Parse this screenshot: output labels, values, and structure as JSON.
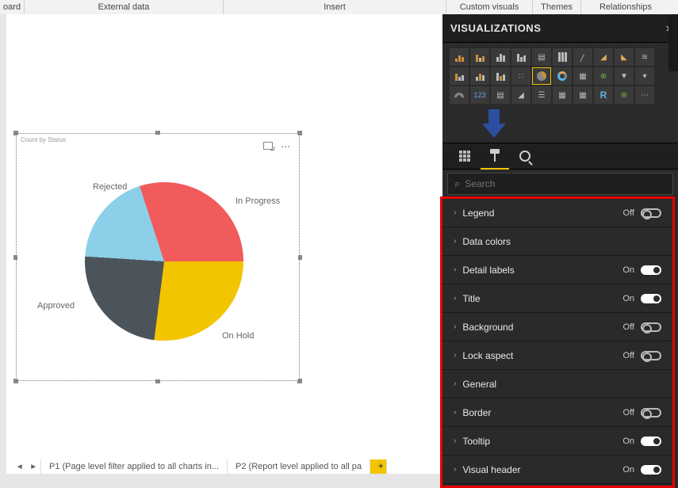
{
  "ribbon": {
    "tabs": [
      "oard",
      "External data",
      "Insert",
      "Custom visuals",
      "Themes",
      "Relationships"
    ]
  },
  "visual": {
    "title": "Count by Status"
  },
  "chart_data": {
    "type": "pie",
    "title": "Count by Status",
    "slices": [
      {
        "label": "In Progress",
        "value": 30,
        "color": "#f15b5b"
      },
      {
        "label": "On Hold",
        "value": 27,
        "color": "#f3c400"
      },
      {
        "label": "Approved",
        "value": 24,
        "color": "#4b545b"
      },
      {
        "label": "Rejected",
        "value": 19,
        "color": "#8bd0e8"
      }
    ]
  },
  "pages": {
    "p1": "P1 (Page level filter applied to all charts in...",
    "p2": "P2 (Report level applied to all pa"
  },
  "panel": {
    "title": "VISUALIZATIONS",
    "search_placeholder": "Search",
    "items": [
      {
        "name": "Legend",
        "state": "Off"
      },
      {
        "name": "Data colors",
        "state": null
      },
      {
        "name": "Detail labels",
        "state": "On"
      },
      {
        "name": "Title",
        "state": "On"
      },
      {
        "name": "Background",
        "state": "Off"
      },
      {
        "name": "Lock aspect",
        "state": "Off"
      },
      {
        "name": "General",
        "state": null
      },
      {
        "name": "Border",
        "state": "Off"
      },
      {
        "name": "Tooltip",
        "state": "On"
      },
      {
        "name": "Visual header",
        "state": "On"
      }
    ]
  }
}
